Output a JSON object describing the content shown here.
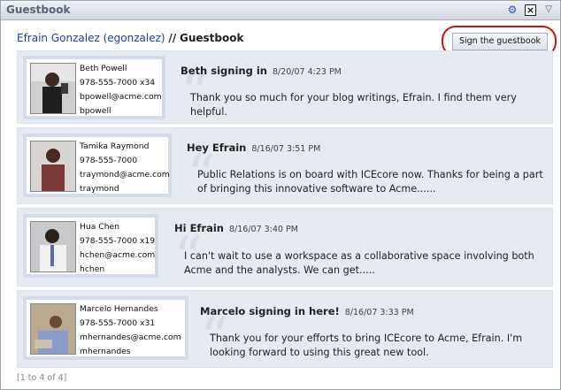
{
  "window": {
    "title": "Guestbook",
    "icons": [
      "gear-icon",
      "close-icon",
      "chevron-down-icon"
    ]
  },
  "breadcrumb": {
    "user": "Efrain Gonzalez (egonzalez)",
    "separator": "//",
    "page": "Guestbook"
  },
  "sign_button": "Sign the guestbook",
  "entries": [
    {
      "name": "Beth Powell",
      "phone": "978-555-7000 x34",
      "email": "bpowell@acme.com",
      "username": "bpowell",
      "title": "Beth signing in",
      "date": "8/20/07 4:23 PM",
      "message": "Thank you so much for your blog writings, Efrain. I find them very helpful."
    },
    {
      "name": "Tamika Raymond",
      "phone": "978-555-7000",
      "email": "traymond@acme.com",
      "username": "traymond",
      "title": "Hey Efrain",
      "date": "8/16/07 3:51 PM",
      "message": "Public Relations is on board with ICEcore now. Thanks for being a part of bringing this innovative software to Acme......"
    },
    {
      "name": "Hua Chen",
      "phone": "978-555-7000 x19",
      "email": "hchen@acme.com",
      "username": "hchen",
      "title": "Hi Efrain",
      "date": "8/16/07 3:40 PM",
      "message": "I can't wait to use a workspace as a collaborative space involving both Acme and the analysts. We can get....."
    },
    {
      "name": "Marcelo Hernandes",
      "phone": "978-555-7000 x31",
      "email": "mhernandes@acme.com",
      "username": "mhernandes",
      "title": "Marcelo signing in here!",
      "date": "8/16/07 3:33 PM",
      "message": "Thank you for your efforts to bring ICEcore to Acme, Efrain. I'm looking forward to using this great new tool."
    }
  ],
  "pagination": "[1 to 4 of 4]",
  "colors": {
    "highlight_circle": "#cc1111",
    "link": "#1c3faa",
    "entry_background": "#e6eaf1"
  }
}
